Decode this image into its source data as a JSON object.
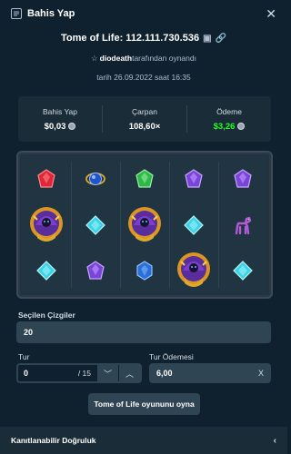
{
  "modal": {
    "title": "Bahis Yap",
    "close_icon": "close-icon"
  },
  "game": {
    "title": "Tome of Life: 112.111.730.536",
    "played_by_user": "diodeath",
    "played_by_suffix": "tarafından oynandı",
    "date": "tarih 26.09.2022 saat 16:35"
  },
  "stats": {
    "bet_label": "Bahis Yap",
    "bet_value": "$0,03",
    "multiplier_label": "Çarpan",
    "multiplier_value": "108,60×",
    "payout_label": "Ödeme",
    "payout_value": "$3,26"
  },
  "board": {
    "reels": [
      [
        "red-gem",
        "wizard",
        "cyan-gem"
      ],
      [
        "blue-orb",
        "cyan-gem",
        "purple-gem"
      ],
      [
        "green-gem",
        "wizard",
        "blue-gem"
      ],
      [
        "purple-gem",
        "cyan-gem",
        "wizard"
      ],
      [
        "purple-gem",
        "llama",
        "cyan-gem"
      ]
    ]
  },
  "form": {
    "lines_label": "Seçilen Çizgiler",
    "lines_value": "20",
    "rounds_label": "Tur",
    "rounds_value": "0",
    "rounds_max": "/ 15",
    "payout_label": "Tur Ödemesi",
    "payout_value": "6,00",
    "payout_suffix": "X",
    "play_button": "Tome of Life oyununu oyna"
  },
  "footer": {
    "label": "Kanıtlanabilir Doğruluk"
  },
  "colors": {
    "background": "#0f212e",
    "panel": "#1a2c38",
    "control": "#2f4553",
    "win_green": "#1fff20"
  }
}
